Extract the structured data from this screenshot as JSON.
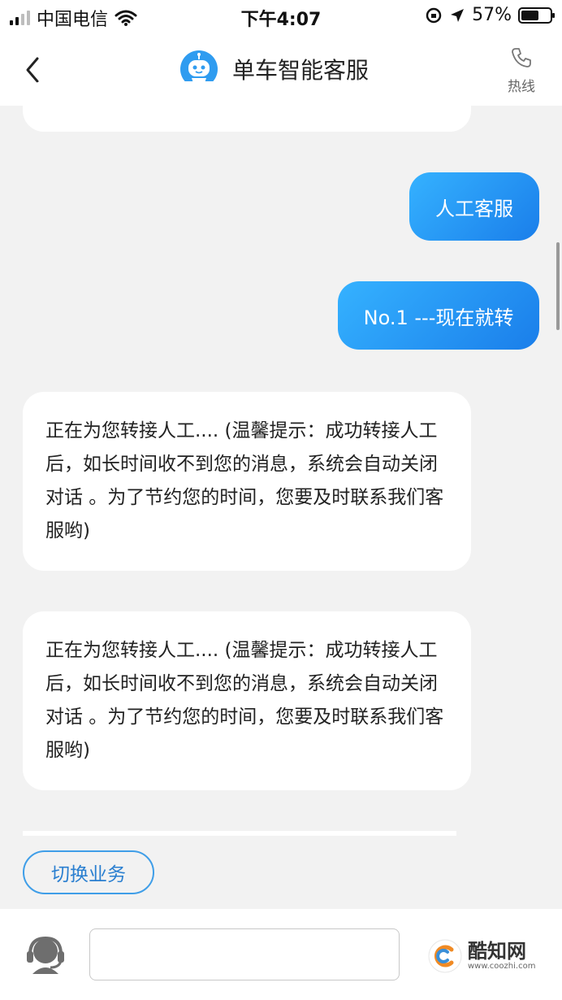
{
  "status_bar": {
    "carrier": "中国电信",
    "time": "下午4:07",
    "battery": "57%",
    "battery_level": 0.57
  },
  "nav": {
    "title": "单车智能客服",
    "hotline_label": "热线"
  },
  "messages": [
    {
      "from": "user",
      "text": "人工客服"
    },
    {
      "from": "user",
      "text": "No.1 ---现在就转"
    },
    {
      "from": "bot",
      "text": "正在为您转接人工.... (温馨提示：成功转接人工后，如长时间收不到您的消息，系统会自动关闭对话 。为了节约您的时间，您要及时联系我们客服哟)"
    },
    {
      "from": "bot",
      "text": "正在为您转接人工.... (温馨提示：成功转接人工后，如长时间收不到您的消息，系统会自动关闭对话 。为了节约您的时间，您要及时联系我们客服哟)"
    }
  ],
  "actions": {
    "switch_business": "切换业务"
  },
  "composer": {
    "placeholder": ""
  },
  "watermark": {
    "name": "酷知网",
    "url": "www.coozhi.com"
  },
  "colors": {
    "user_bubble_start": "#35b2ff",
    "user_bubble_end": "#1a7eea",
    "accent": "#3f9ee8",
    "background": "#f2f2f2"
  }
}
